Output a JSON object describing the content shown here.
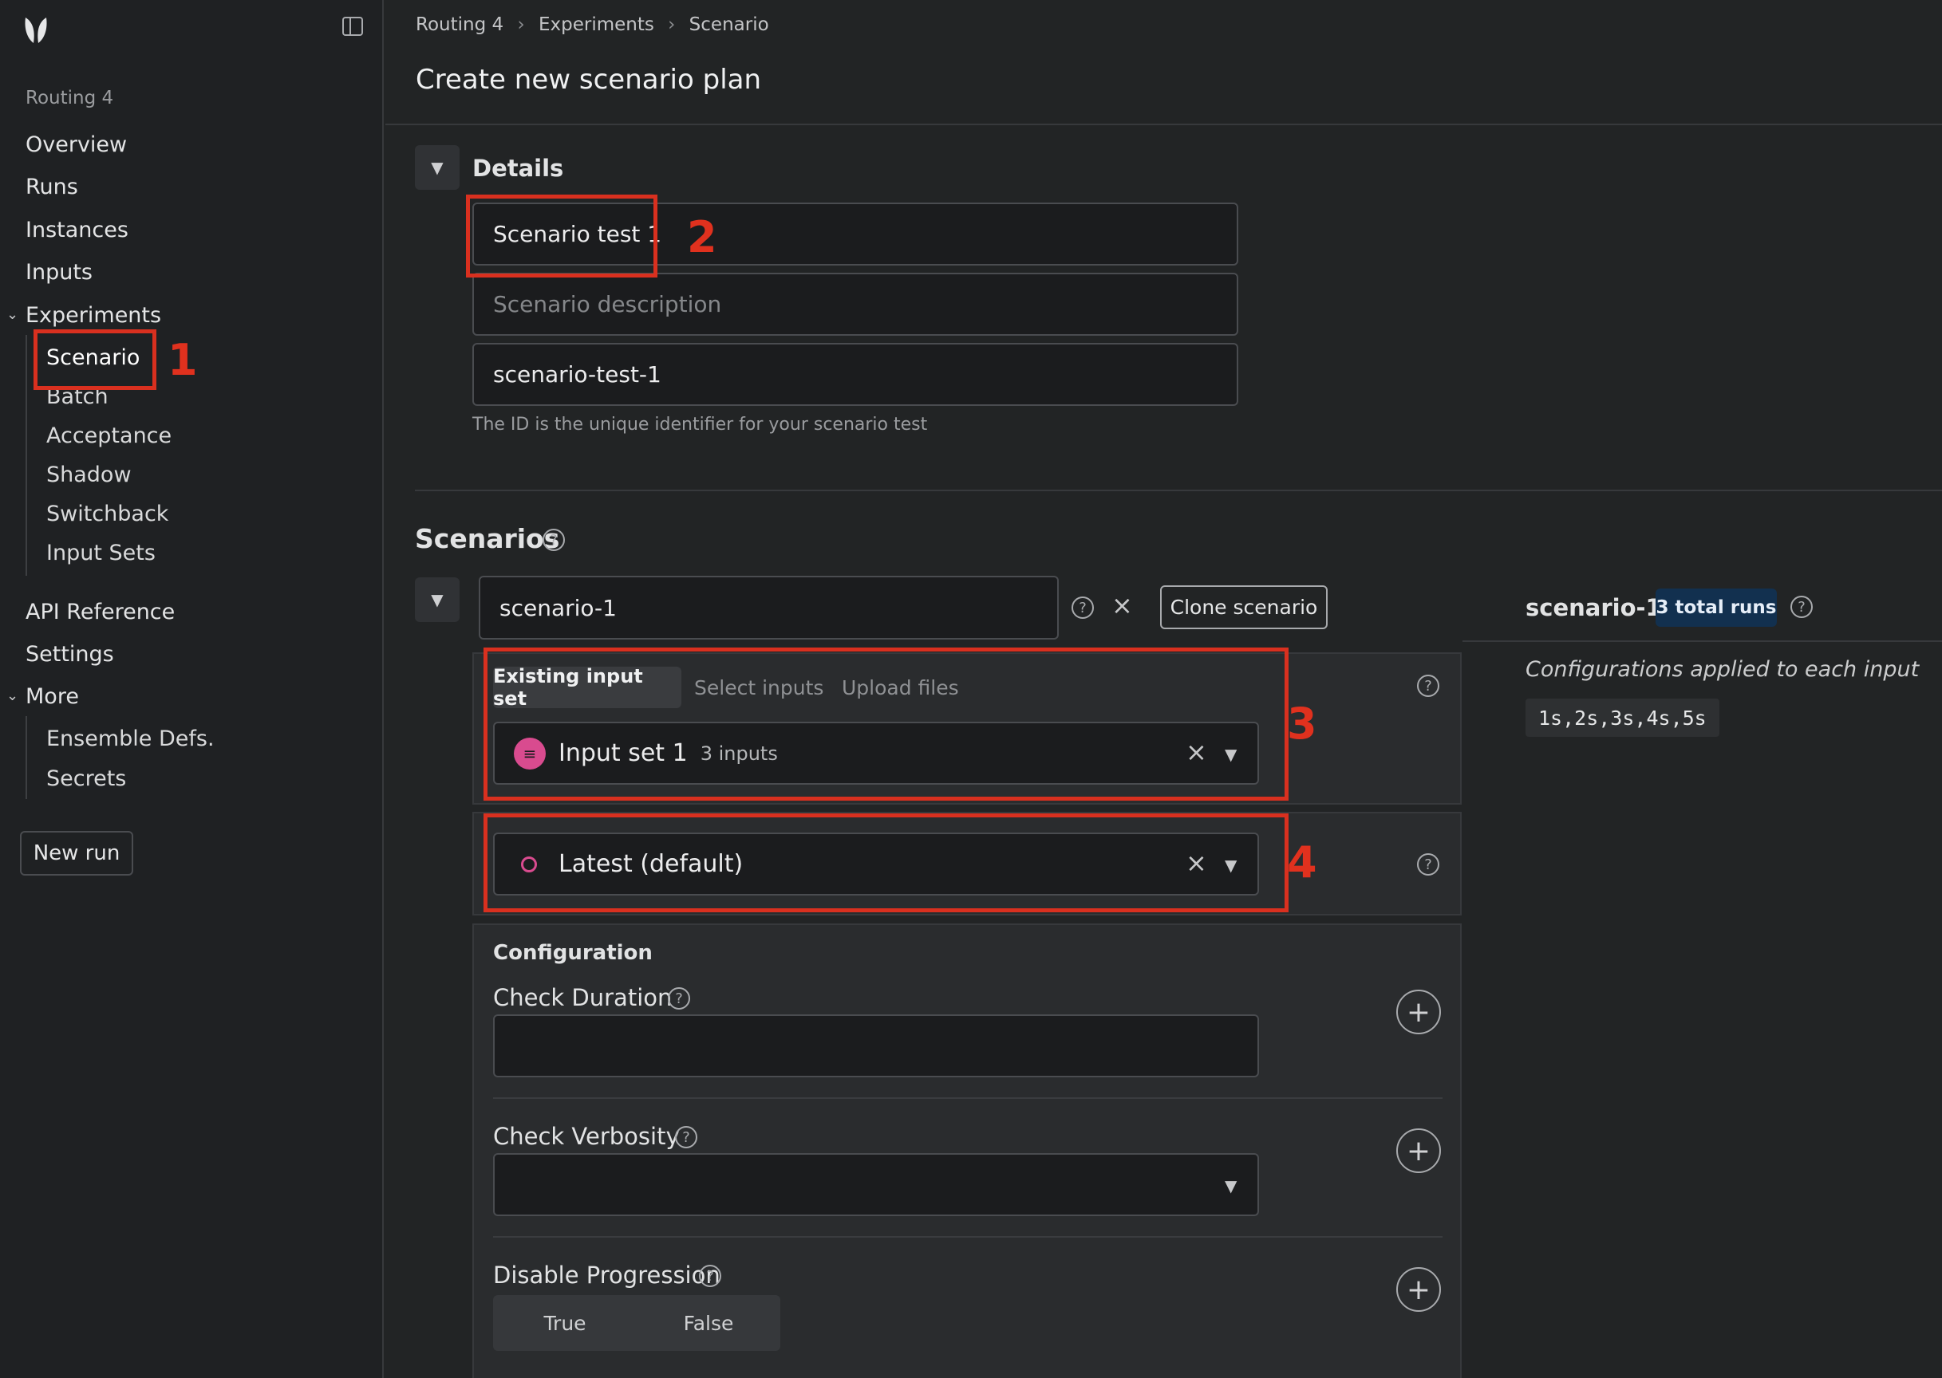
{
  "sidebar": {
    "org": "Routing 4",
    "items": [
      "Overview",
      "Runs",
      "Instances",
      "Inputs"
    ],
    "experiments_label": "Experiments",
    "experiments_sub": [
      "Scenario",
      "Batch",
      "Acceptance",
      "Shadow",
      "Switchback",
      "Input Sets"
    ],
    "items2": [
      "API Reference",
      "Settings"
    ],
    "more_label": "More",
    "more_sub": [
      "Ensemble Defs.",
      "Secrets"
    ],
    "new_run": "New run"
  },
  "breadcrumb": [
    "Routing 4",
    "Experiments",
    "Scenario"
  ],
  "page_title": "Create new scenario plan",
  "details": {
    "label": "Details",
    "name_value": "Scenario test 1",
    "description_placeholder": "Scenario description",
    "id_value": "scenario-test-1",
    "id_hint": "The ID is the unique identifier for your scenario test"
  },
  "scenarios": {
    "title": "Scenarios",
    "scenario_name": "scenario-1",
    "clone_label": "Clone scenario",
    "tabs": [
      "Existing input set",
      "Select inputs",
      "Upload files"
    ],
    "input_set_name": "Input set 1",
    "input_set_count": "3 inputs",
    "instance_value": "Latest (default)",
    "config_title": "Configuration",
    "check_duration_label": "Check Duration",
    "check_verbosity_label": "Check Verbosity",
    "disable_progression_label": "Disable Progression",
    "toggle_true": "True",
    "toggle_false": "False"
  },
  "summary": {
    "name": "scenario-1",
    "runs_badge": "3 total runs",
    "config_note": "Configurations applied to each input",
    "config_values": "1s,2s,3s,4s,5s"
  },
  "annotations": [
    "1",
    "2",
    "3",
    "4"
  ],
  "colors": {
    "annotation": "#d9301f",
    "badge_bg": "#12304f",
    "input_icon": "#d94b8f"
  }
}
